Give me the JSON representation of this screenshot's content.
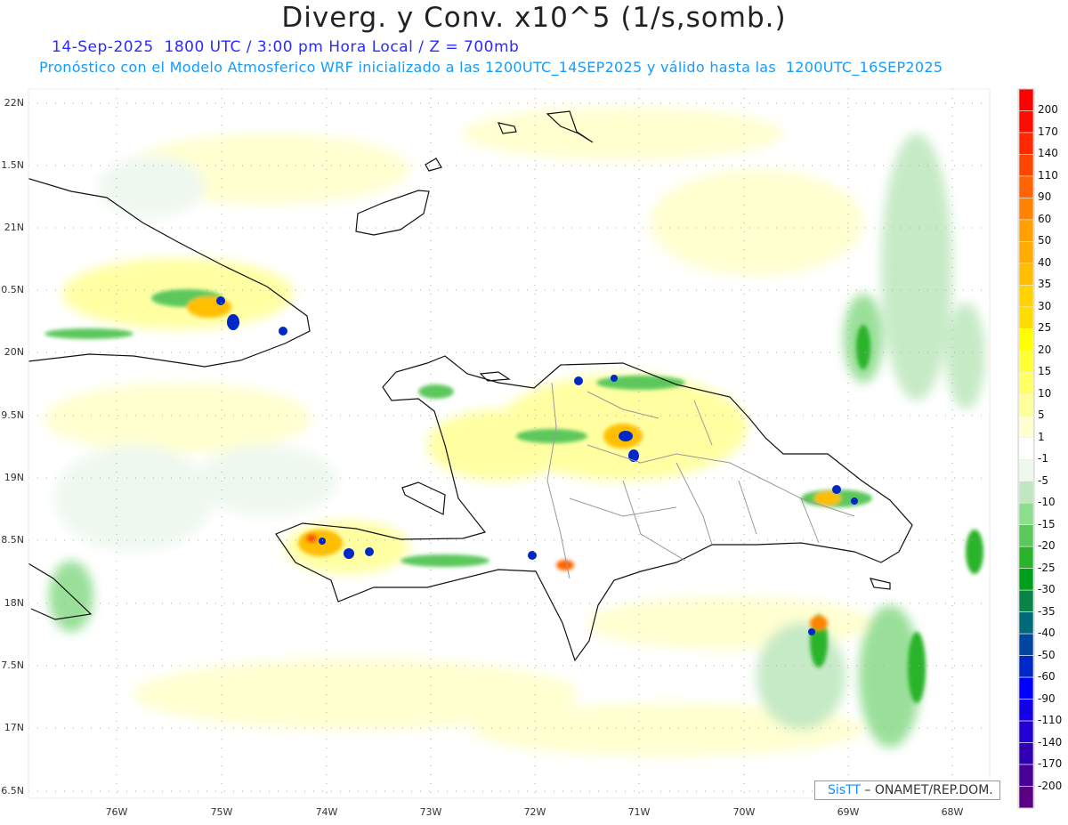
{
  "header": {
    "title": "Diverg. y Conv. x10^5 (1/s,somb.)",
    "line1": "14-Sep-2025  1800 UTC / 3:00 pm Hora Local / Z = 700mb",
    "line2": "Pronóstico con el Modelo Atmosferico WRF inicializado a las 1200UTC_14SEP2025 y válido hasta las  1200UTC_16SEP2025"
  },
  "axes": {
    "lat_labels": [
      "22N",
      "1.5N",
      "21N",
      "0.5N",
      "20N",
      "9.5N",
      "19N",
      "8.5N",
      "18N",
      "7.5N",
      "17N",
      "6.5N"
    ],
    "lon_labels": [
      "76W",
      "75W",
      "74W",
      "73W",
      "72W",
      "71W",
      "70W",
      "69W",
      "68W"
    ]
  },
  "colorbar": {
    "labels": [
      "200",
      "170",
      "140",
      "110",
      "90",
      "60",
      "50",
      "40",
      "35",
      "30",
      "25",
      "20",
      "15",
      "10",
      "5",
      "1",
      "-1",
      "-5",
      "-10",
      "-15",
      "-20",
      "-25",
      "-30",
      "-35",
      "-40",
      "-50",
      "-60",
      "-90",
      "-110",
      "-140",
      "-170",
      "-200"
    ],
    "colors": [
      "#ff0000",
      "#ff0c00",
      "#ff2800",
      "#ff4600",
      "#ff6400",
      "#ff8200",
      "#ffa000",
      "#ffab00",
      "#ffbe00",
      "#ffd200",
      "#ffdc00",
      "#ffff00",
      "#ffff35",
      "#ffff66",
      "#ffff99",
      "#ffffd2",
      "#ffffff",
      "#eef8ee",
      "#c0e8c0",
      "#8edc8e",
      "#5cc85c",
      "#2ab42a",
      "#00a01e",
      "#0a8248",
      "#006a78",
      "#0046a0",
      "#0028c8",
      "#0000ff",
      "#1400e6",
      "#2400d2",
      "#3200b4",
      "#460096",
      "#5a0082"
    ]
  },
  "credit": {
    "brand": "SisTT",
    "text": "– ONAMET/REP.DOM."
  }
}
